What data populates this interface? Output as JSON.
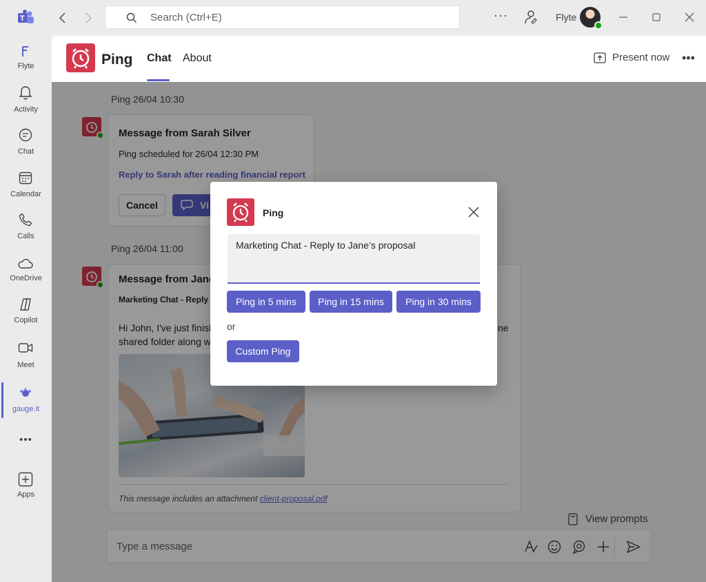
{
  "titlebar": {
    "search_placeholder": "Search (Ctrl+E)",
    "user_name": "Flyte",
    "more_label": "···"
  },
  "rail": {
    "items": [
      {
        "label": "Flyte",
        "icon": "flyte-logo-icon"
      },
      {
        "label": "Activity",
        "icon": "bell-icon"
      },
      {
        "label": "Chat",
        "icon": "chat-icon"
      },
      {
        "label": "Calendar",
        "icon": "calendar-icon"
      },
      {
        "label": "Calls",
        "icon": "phone-icon"
      },
      {
        "label": "OneDrive",
        "icon": "cloud-icon"
      },
      {
        "label": "Copilot",
        "icon": "copilot-icon"
      },
      {
        "label": "Meet",
        "icon": "video-icon"
      },
      {
        "label": "gauge.it",
        "icon": "gauge-it-icon"
      },
      {
        "label": "Apps",
        "icon": "add-apps-icon"
      }
    ],
    "more_label": "•••"
  },
  "header": {
    "app_name": "Ping",
    "tabs": [
      {
        "label": "Chat",
        "active": true
      },
      {
        "label": "About",
        "active": false
      }
    ],
    "present_label": "Present now",
    "more_label": "•••"
  },
  "messages": [
    {
      "stamp": "Ping 26/04 10:30",
      "title": "Message from Sarah Silver",
      "text": "Ping scheduled for 26/04 12:30 PM",
      "link": "Reply to Sarah after reading financial report",
      "cancel_label": "Cancel",
      "view_label": "Vi"
    },
    {
      "stamp": "Ping 26/04 11:00",
      "title": "Message from Jane I",
      "subtitle": "Marketing Chat - Reply",
      "body_line1": "Hi John, I've just finish",
      "body_line1_end": "ne",
      "body_line2": "shared folder along w",
      "attachment_note": "This message includes an attachment ",
      "attachment_name": "client-proposal.pdf"
    }
  ],
  "view_prompts_label": "View prompts",
  "composer": {
    "placeholder": "Type a message"
  },
  "dialog": {
    "title": "Ping",
    "field_value": "Marketing Chat - Reply to Jane’s proposal",
    "buttons": [
      "Ping in 5 mins",
      "Ping in 15 mins",
      "Ping in 30 mins"
    ],
    "or_label": "or",
    "custom_label": "Custom Ping"
  },
  "colors": {
    "accent": "#5b5fc7",
    "brand_red": "#d43a4f",
    "presence_green": "#13a10e"
  }
}
